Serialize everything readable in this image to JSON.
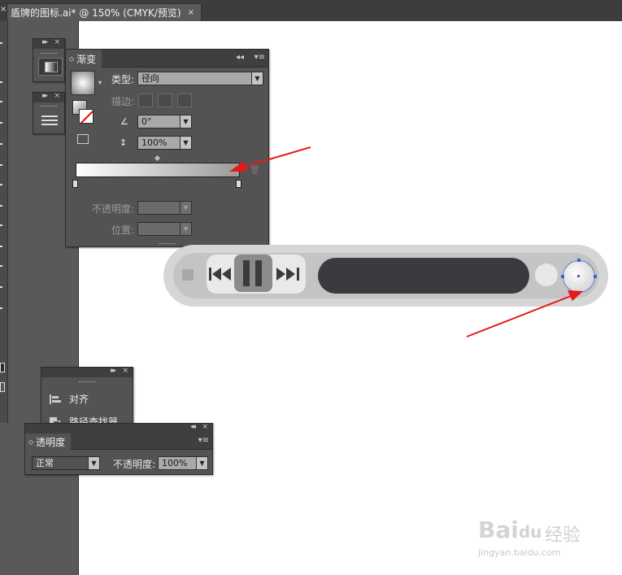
{
  "document_tab": {
    "title": "盾牌的图标.ai* @ 150% (CMYK/预览)",
    "close": "×"
  },
  "tabbar": {
    "left_close": "×"
  },
  "panel_controls": {
    "collapse": "▸▸",
    "close": "×",
    "menu": "▾≡",
    "collapse_left": "◂◂"
  },
  "gradient_panel": {
    "tab_label": "渐变",
    "type_label": "类型:",
    "type_value": "径向",
    "stroke_label": "描边:",
    "angle_value": "0°",
    "aspect_value": "100%",
    "opacity_label": "不透明度:",
    "location_label": "位置:",
    "gradient_stops": {
      "start_color": "#ffffff",
      "end_color": "#9a9a9a"
    }
  },
  "align_panel": {
    "items": [
      {
        "label": "对齐",
        "icon": "align-icon"
      },
      {
        "label": "路径查找器",
        "icon": "pathfinder-icon"
      }
    ]
  },
  "transparency_panel": {
    "tab_label": "透明度",
    "blend_mode": "正常",
    "opacity_label": "不透明度:",
    "opacity_value": "100%"
  },
  "annotations": {
    "arrow_color": "#e81818"
  },
  "player_art": {
    "track_color": "#3b3a3f",
    "shell_color": "#d6d6d6",
    "selection_color": "#3a64d8"
  },
  "watermark": {
    "brand": "Bai",
    "brand_suffix": "du",
    "label": "经验",
    "url": "jingyan.baidu.com"
  }
}
